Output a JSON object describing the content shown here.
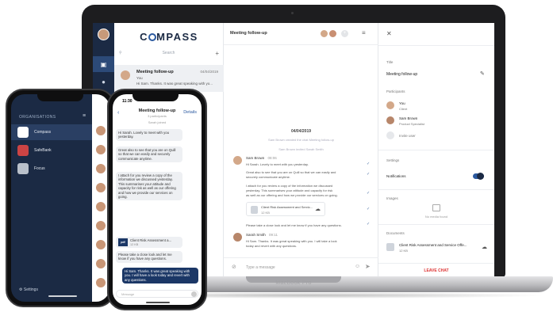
{
  "macbook": {
    "label": "MacBook Pro",
    "app": {
      "logo_text": "COMPASS",
      "search_placeholder": "Search",
      "conversation": {
        "title": "Meeting follow-up",
        "date": "04/04/2019",
        "sender_line": "You",
        "preview": "Hi Sam. Thanks. It was great speaking with yo..."
      },
      "chat": {
        "title": "Meeting follow-up",
        "date_divider": "04/04/2019",
        "system_messages": [
          "Sam Brown created the chat Meeting follow-up",
          "Sam Brown invited Sarah Smith"
        ],
        "messages": [
          {
            "name": "Sam Brown",
            "time": "08:06",
            "lines": [
              "Hi Sarah. Lovely to meet with you yesterday.",
              "Great also to see that you are on Quill so that we can easily and",
              "securely communicate anytime.",
              "I attach for you review a copy of the information we discussed",
              "yesterday. This summarises your attitude and capacity for risk",
              "as well as our offering and how we provide our services on going."
            ],
            "attachment": {
              "name": "Client Risk Assessment and Servic...",
              "size": "12 KB"
            },
            "after": "Please take a close look and let me know if you have any questions."
          },
          {
            "name": "Sarah Smith",
            "time": "09:11",
            "lines": [
              "Hi Sam. Thanks. It was great speaking with you. I will take a look",
              "today and revert with any questions."
            ]
          }
        ],
        "composer_placeholder": "Type a message"
      },
      "details": {
        "title_label": "Title",
        "title_value": "Meeting follow-up",
        "participants_label": "Participants",
        "participants": [
          {
            "name": "You",
            "role": "Client"
          },
          {
            "name": "Sam Brown",
            "role": "Product Specialist"
          }
        ],
        "invite_label": "Invite user",
        "settings_label": "Settings",
        "notifications_label": "Notifications",
        "notifications_on": true,
        "images_label": "Images",
        "no_media": "No media found",
        "documents_label": "Documents",
        "document": {
          "name": "Client Risk Assessment and Service Offe...",
          "size": "12 KB"
        },
        "leave_label": "LEAVE CHAT"
      }
    }
  },
  "phone_left": {
    "section_title": "ORGANISATIONS",
    "orgs": [
      "Compass",
      "SafeBank",
      "Focus"
    ],
    "settings_label": "Settings"
  },
  "phone_right": {
    "time": "11:30",
    "title": "Meeting follow-up",
    "subtitle": "3 participants",
    "details_label": "Details",
    "back_label": "‹",
    "sys_note": "Sarah joined",
    "bubbles": [
      "Hi Sarah. Lovely to meet with you yesterday.",
      "Great also to see that you are on Quill so that we can easily and securely communicate anytime.",
      "I attach for you review a copy of the information we discussed yesterday. This summarises your attitude and capacity for risk as well as our offering and how we provide our services on going."
    ],
    "file": {
      "name": "Client Risk Assessment a...",
      "size": "12 KB"
    },
    "bubble_after": "Please take a close look and let me know if you have any questions.",
    "my_bubble": "Hi Sam. Thanks. It was great speaking with you. I will have a look today and revert with any questions.",
    "input_placeholder": "Message"
  },
  "colors": {
    "navy": "#1b2a44",
    "accent": "#2c5aa0",
    "danger": "#dd3333"
  }
}
